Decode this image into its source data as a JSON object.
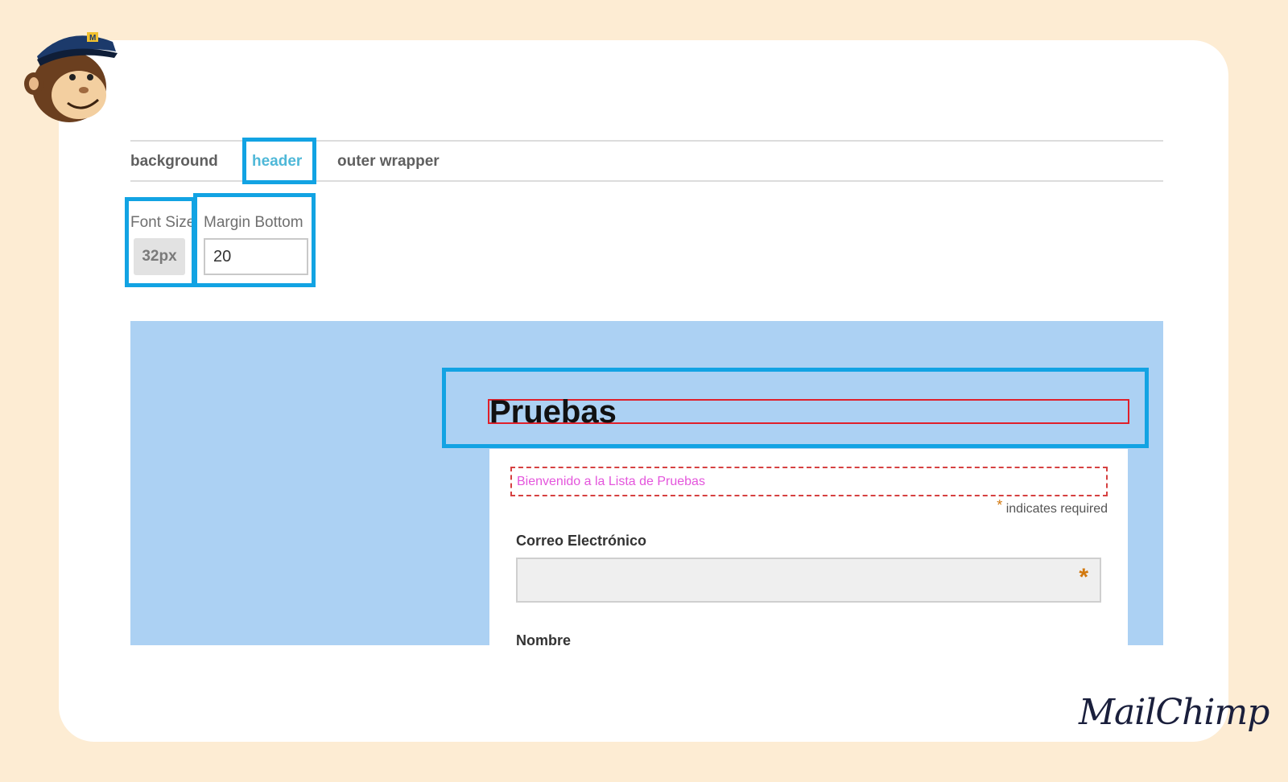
{
  "tabs": {
    "background": "background",
    "header": "header",
    "outer_wrapper": "outer wrapper"
  },
  "fields": {
    "font_size_label": "Font Size",
    "font_size_value": "32px",
    "margin_bottom_label": "Margin Bottom",
    "margin_bottom_value": "20"
  },
  "preview": {
    "title": "Pruebas",
    "welcome": "Bienvenido a la Lista de Pruebas",
    "required_star": "*",
    "required_note": "indicates required",
    "email_label": "Correo Electrónico",
    "email_star": "*",
    "next_label": "Nombre"
  },
  "brand": {
    "wordmark": "MailChimp"
  },
  "colors": {
    "background": "#fdecd3",
    "highlight": "#12a3e3",
    "active_tab": "#4fb8d8",
    "preview_bg": "#acd1f3"
  },
  "icons": [
    "mailchimp-freddie-mascot-icon"
  ]
}
